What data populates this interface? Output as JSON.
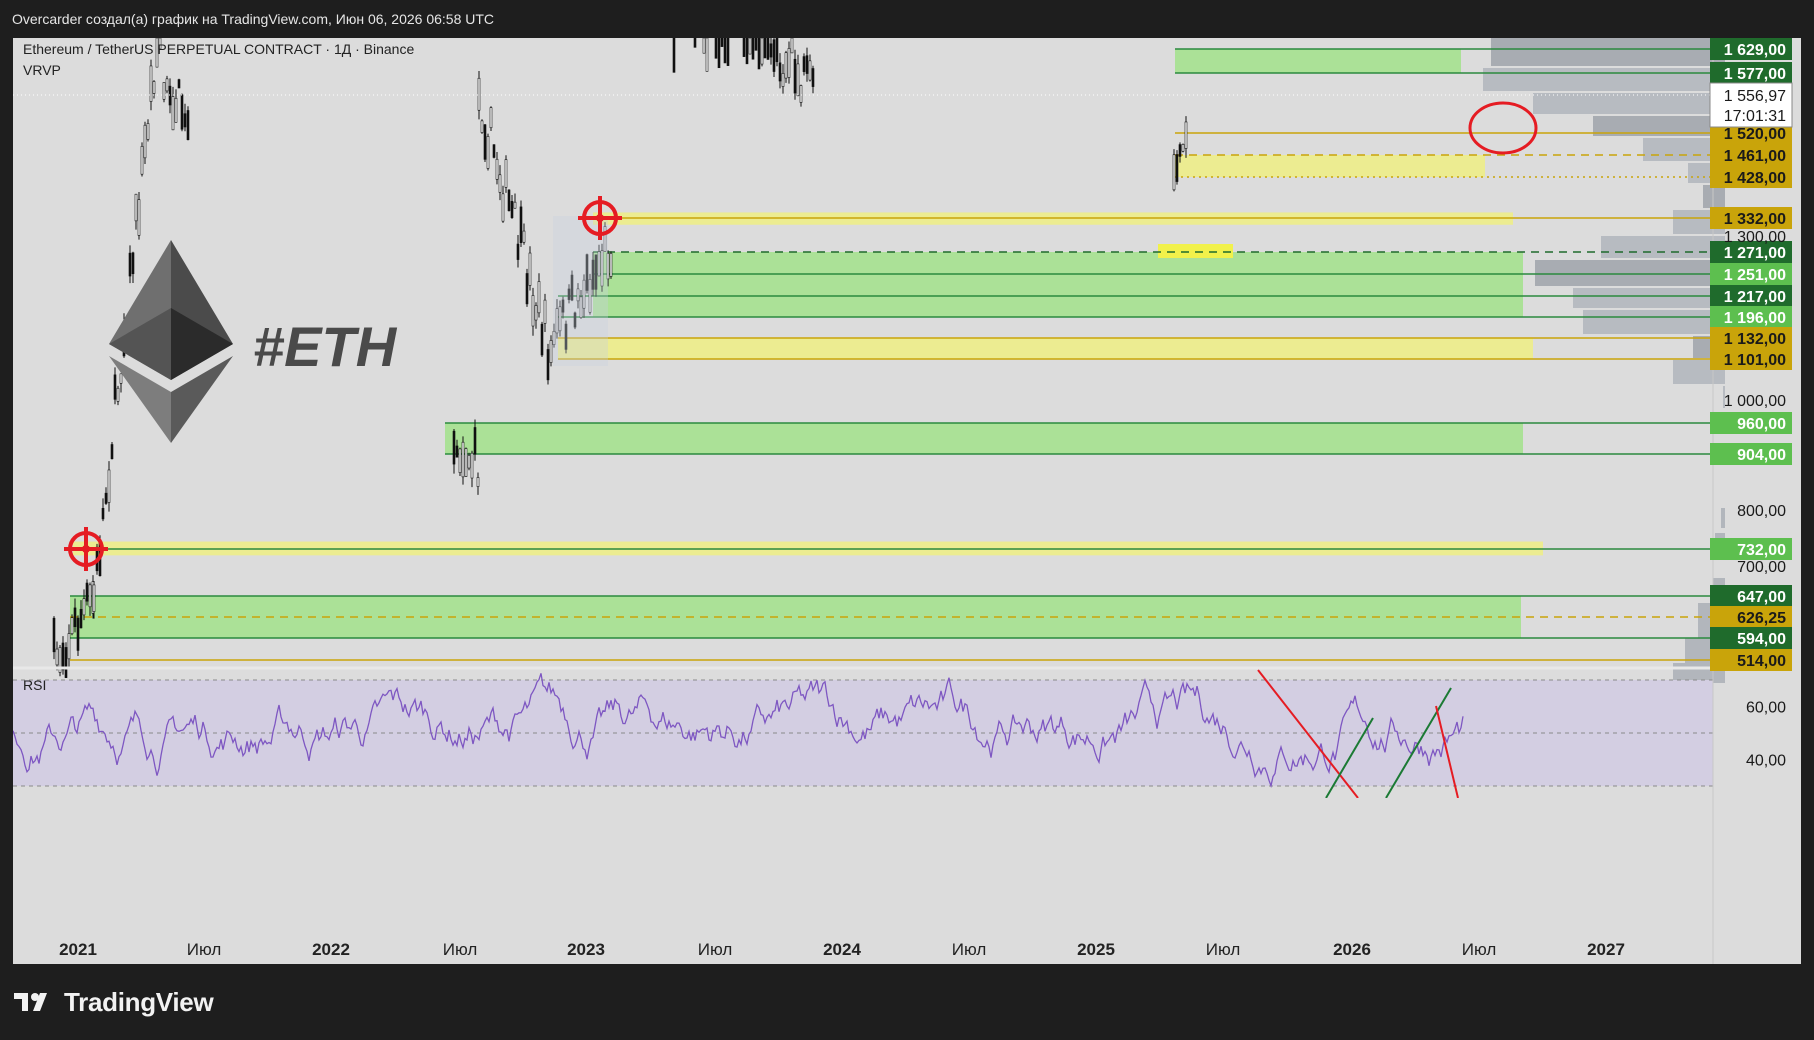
{
  "header": {
    "caption": "Overcarder создал(а) график на TradingView.com, Июн 06, 2026 06:58 UTC"
  },
  "symbol": {
    "title": "Ethereum / TetherUS PERPETUAL CONTRACT · 1Д · Binance",
    "indicator": "VRVP",
    "watermark": "#ETH"
  },
  "footer": {
    "brand": "TradingView"
  },
  "colors": {
    "chart_bg": "#dcdcdc",
    "green_zone": "#a8e092",
    "yellow_zone": "#ecec8c",
    "green_tag": "#1f6b2c",
    "light_green_tag": "#5dbf4f",
    "gold_tag": "#c9a40a",
    "rsi_line": "#7e57c2",
    "rsi_band": "#d3cee2",
    "trend_red": "#e51c23",
    "trend_green": "#1b7a34"
  },
  "chart_data": {
    "type": "candlestick",
    "x_ticks": [
      {
        "label": "2021",
        "bold": true
      },
      {
        "label": "Июл",
        "bold": false
      },
      {
        "label": "2022",
        "bold": true
      },
      {
        "label": "Июл",
        "bold": false
      },
      {
        "label": "2023",
        "bold": true
      },
      {
        "label": "Июл",
        "bold": false
      },
      {
        "label": "2024",
        "bold": true
      },
      {
        "label": "Июл",
        "bold": false
      },
      {
        "label": "2025",
        "bold": true
      },
      {
        "label": "Июл",
        "bold": false
      },
      {
        "label": "2026",
        "bold": true
      },
      {
        "label": "Июл",
        "bold": false
      },
      {
        "label": "2027",
        "bold": true
      }
    ],
    "y_axis_labels": [
      "1 300,00",
      "1 000,00",
      "800,00",
      "700,00"
    ],
    "current_price": {
      "value": "1 556,97",
      "countdown": "17:01:31"
    },
    "price_tags": [
      {
        "value": 1629,
        "label": "1 629,00",
        "style": "dark"
      },
      {
        "value": 1577,
        "label": "1 577,00",
        "style": "dark"
      },
      {
        "value": 1520,
        "label": "1 520,00",
        "style": "gold"
      },
      {
        "value": 1461,
        "label": "1 461,00",
        "style": "gold"
      },
      {
        "value": 1428,
        "label": "1 428,00",
        "style": "gold"
      },
      {
        "value": 1332,
        "label": "1 332,00",
        "style": "gold"
      },
      {
        "value": 1271,
        "label": "1 271,00",
        "style": "dark"
      },
      {
        "value": 1251,
        "label": "1 251,00",
        "style": "light"
      },
      {
        "value": 1217,
        "label": "1 217,00",
        "style": "dark"
      },
      {
        "value": 1196,
        "label": "1 196,00",
        "style": "light"
      },
      {
        "value": 1132,
        "label": "1 132,00",
        "style": "gold"
      },
      {
        "value": 1101,
        "label": "1 101,00",
        "style": "gold"
      },
      {
        "value": 960,
        "label": "960,00",
        "style": "light"
      },
      {
        "value": 904,
        "label": "904,00",
        "style": "light"
      },
      {
        "value": 732,
        "label": "732,00",
        "style": "light"
      },
      {
        "value": 647,
        "label": "647,00",
        "style": "dark"
      },
      {
        "value": 626.25,
        "label": "626,25",
        "style": "gold"
      },
      {
        "value": 594,
        "label": "594,00",
        "style": "dark"
      },
      {
        "value": 514,
        "label": "514,00",
        "style": "gold"
      }
    ],
    "zones": [
      {
        "kind": "green",
        "from": 1577,
        "to": 1629
      },
      {
        "kind": "yellow",
        "from": 1428,
        "to": 1461
      },
      {
        "kind": "yellow",
        "from": 1320,
        "to": 1345
      },
      {
        "kind": "green",
        "from": 1196,
        "to": 1271
      },
      {
        "kind": "yellow",
        "from": 1101,
        "to": 1132
      },
      {
        "kind": "green",
        "from": 904,
        "to": 960
      },
      {
        "kind": "yellow",
        "from": 720,
        "to": 745
      },
      {
        "kind": "green",
        "from": 594,
        "to": 647
      }
    ],
    "rsi": {
      "label": "RSI",
      "levels": [
        "60,00",
        "40,00"
      ],
      "range": [
        30,
        70
      ]
    }
  }
}
